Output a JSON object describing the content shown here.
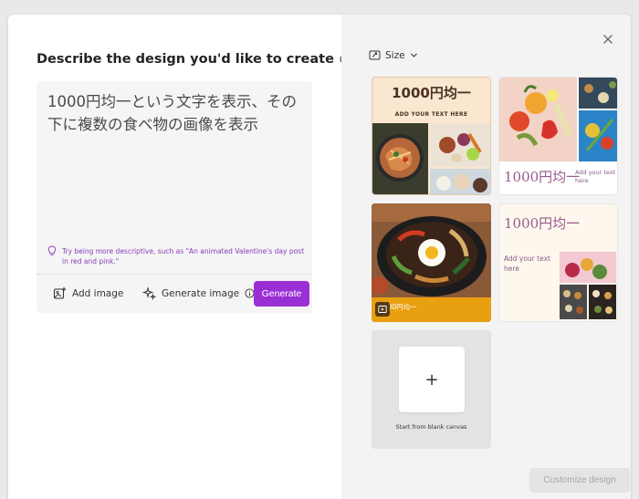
{
  "prompt_panel": {
    "heading": "Describe the design you'd like to create",
    "prompt_text": "1000円均一という文字を表示、その下に複数の食べ物の画像を表示",
    "hint": "Try being more descriptive, such as \"An animated Valentine's day post in red and pink.\"",
    "add_image_label": "Add image",
    "generate_image_label": "Generate image",
    "generate_label": "Generate"
  },
  "results_panel": {
    "size_label": "Size",
    "cards": [
      {
        "title": "1000円均一",
        "subtitle": "ADD YOUR TEXT HERE"
      },
      {
        "title": "1000円均一",
        "subtitle": "Add your text here"
      },
      {
        "title": "1000円均一"
      },
      {
        "title": "1000円均一",
        "subtitle": "Add your text here"
      }
    ],
    "blank_canvas_label": "Start from blank canvas",
    "customize_label": "Customize design"
  },
  "colors": {
    "accent": "#9b2fd6",
    "hint_text": "#8a3ab9",
    "card1_bg": "#fbe6cf",
    "card3_bar": "#e8a010",
    "title_mauve": "#9a5a8e"
  }
}
